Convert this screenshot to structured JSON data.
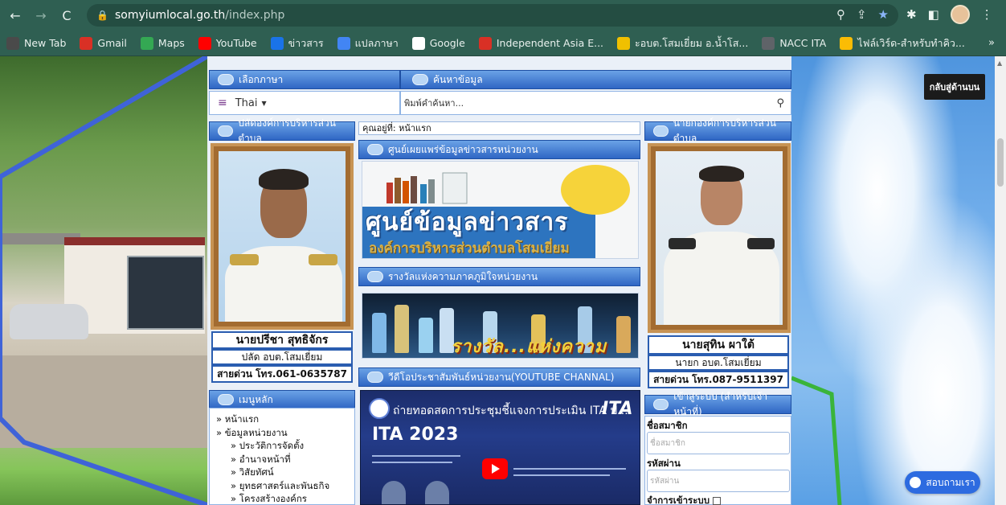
{
  "browser": {
    "url_host": "somyiumlocal.go.th",
    "url_path": "/index.php",
    "bookmarks": [
      "New Tab",
      "Gmail",
      "Maps",
      "YouTube",
      "ข่าวสาร",
      "แปลภาษา",
      "Google",
      "Independent Asia E...",
      "ะอบต.โสมเยี่ยม อ.น้ำโส...",
      "NACC ITA",
      "ไฟล์เวิร์ด-สำหรับทำคิว..."
    ],
    "bookmark_colors": [
      "#4a4a4a",
      "#d93025",
      "#34a853",
      "#ff0000",
      "#1a73e8",
      "#4285f4",
      "#ffffff",
      "#d93025",
      "#f0c000",
      "#5f6368",
      "#fbbc04"
    ],
    "more": "»"
  },
  "page": {
    "back_to_top": "กลับสู่ด้านบน",
    "ask_button": "สอบถามเรา",
    "language": {
      "header": "เลือกภาษา",
      "current": "Thai"
    },
    "search": {
      "header": "ค้นหาข้อมูล",
      "placeholder": "พิมพ์คำค้นหา..."
    },
    "breadcrumb": "คุณอยู่ที่: หน้าแรก",
    "left_official": {
      "header": "ปลัดองค์การบริหารส่วนตำบล",
      "name": "นายปรีชา สุทธิจักร",
      "position": "ปลัด อบต.โสมเยี่ยม",
      "hotline": "สายด่วน โทร.061-0635787"
    },
    "right_official": {
      "header": "นายกองค์การบริหารส่วนตำบล",
      "name": "นายสุทิน ผาใต้",
      "position": "นายก อบต.โสมเยี่ยม",
      "hotline": "สายด่วน โทร.087-9511397"
    },
    "info_center": {
      "header": "ศูนย์เผยแพร่ข้อมูลข่าวสารหน่วยงาน",
      "title": "ศูนย์ข้อมูลข่าวสาร",
      "subtitle": "องค์การบริหารส่วนตำบลโสมเยี่ยม"
    },
    "awards": {
      "header": "รางวัลแห่งความภาคภูมิใจหน่วยงาน",
      "banner_text": "รางวัล...แห่งความภาคภูมิใจ"
    },
    "video": {
      "header": "วีดีโอประชาสัมพันธ์หน่วยงาน(YOUTUBE CHANNAL)",
      "title": "ถ่ายทอดสดการประชุมชี้แจงการประเมิน ITA ป...",
      "ita_text": "ITA 2023",
      "ita_logo": "ITA"
    },
    "main_menu": {
      "header": "เมนูหลัก",
      "items": [
        {
          "label": "» หน้าแรก",
          "sub": false
        },
        {
          "label": "» ข้อมูลหน่วยงาน",
          "sub": false
        },
        {
          "label": "» ประวัติการจัดตั้ง",
          "sub": true
        },
        {
          "label": "» อำนาจหน้าที่",
          "sub": true
        },
        {
          "label": "» วิสัยทัศน์",
          "sub": true
        },
        {
          "label": "» ยุทธศาสตร์และพันธกิจ",
          "sub": true
        },
        {
          "label": "» โครงสร้างองค์กร",
          "sub": true
        }
      ]
    },
    "login": {
      "header": "เข้าสู่ระบบ (สำหรับเจ้าหน้าที่)",
      "username_label": "ชื่อสมาชิก",
      "username_placeholder": "ชื่อสมาชิก",
      "password_label": "รหัสผ่าน",
      "password_placeholder": "รหัสผ่าน",
      "remember_label": "จำการเข้าระบบ"
    }
  }
}
